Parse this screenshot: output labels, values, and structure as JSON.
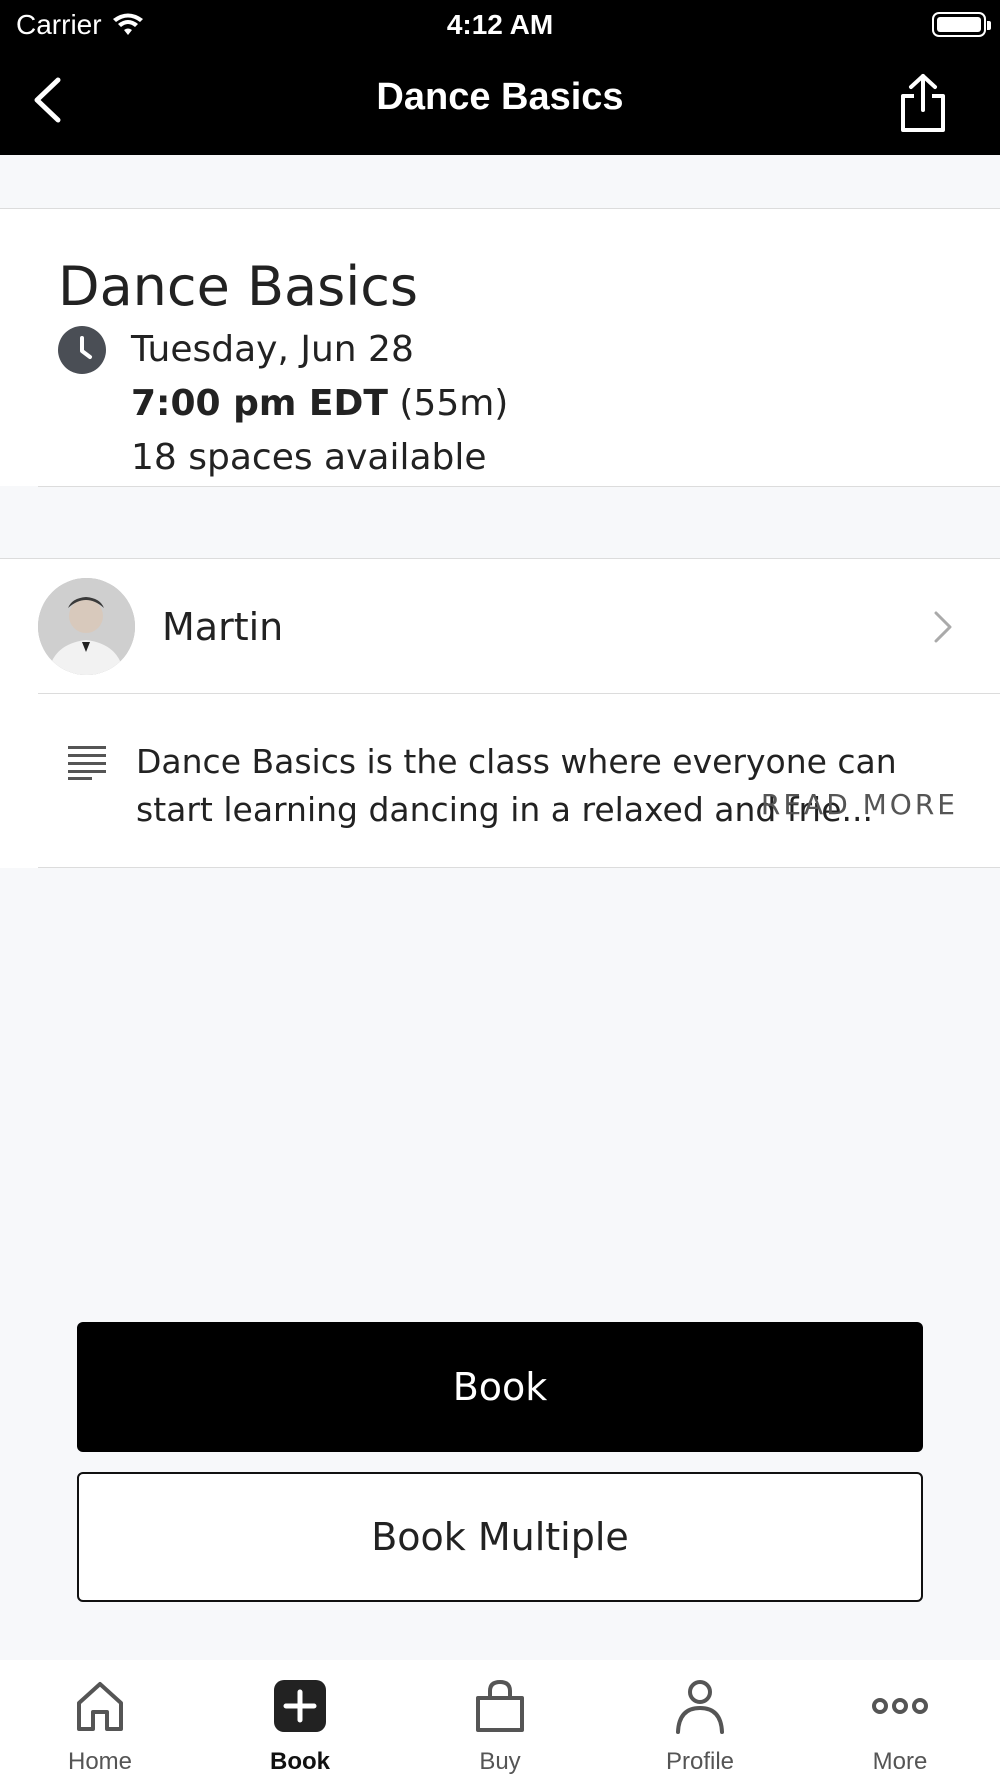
{
  "status_bar": {
    "carrier": "Carrier",
    "time": "4:12 AM"
  },
  "nav": {
    "title": "Dance Basics"
  },
  "class": {
    "title": "Dance Basics",
    "date": "Tuesday, Jun 28",
    "time_bold": "7:00 pm EDT",
    "duration": "(55m)",
    "spaces": "18 spaces available"
  },
  "instructor": {
    "name": "Martin"
  },
  "description": {
    "text": "Dance Basics is the class where everyone can start learning dancing in a relaxed and frie...",
    "read_more": "READ MORE"
  },
  "actions": {
    "book_label": "Book",
    "book_multiple_label": "Book Multiple"
  },
  "tabs": [
    {
      "label": "Home",
      "icon": "home-icon"
    },
    {
      "label": "Book",
      "icon": "book-plus-icon",
      "active": true
    },
    {
      "label": "Buy",
      "icon": "shopping-bag-icon"
    },
    {
      "label": "Profile",
      "icon": "person-icon"
    },
    {
      "label": "More",
      "icon": "more-dots-icon"
    }
  ]
}
